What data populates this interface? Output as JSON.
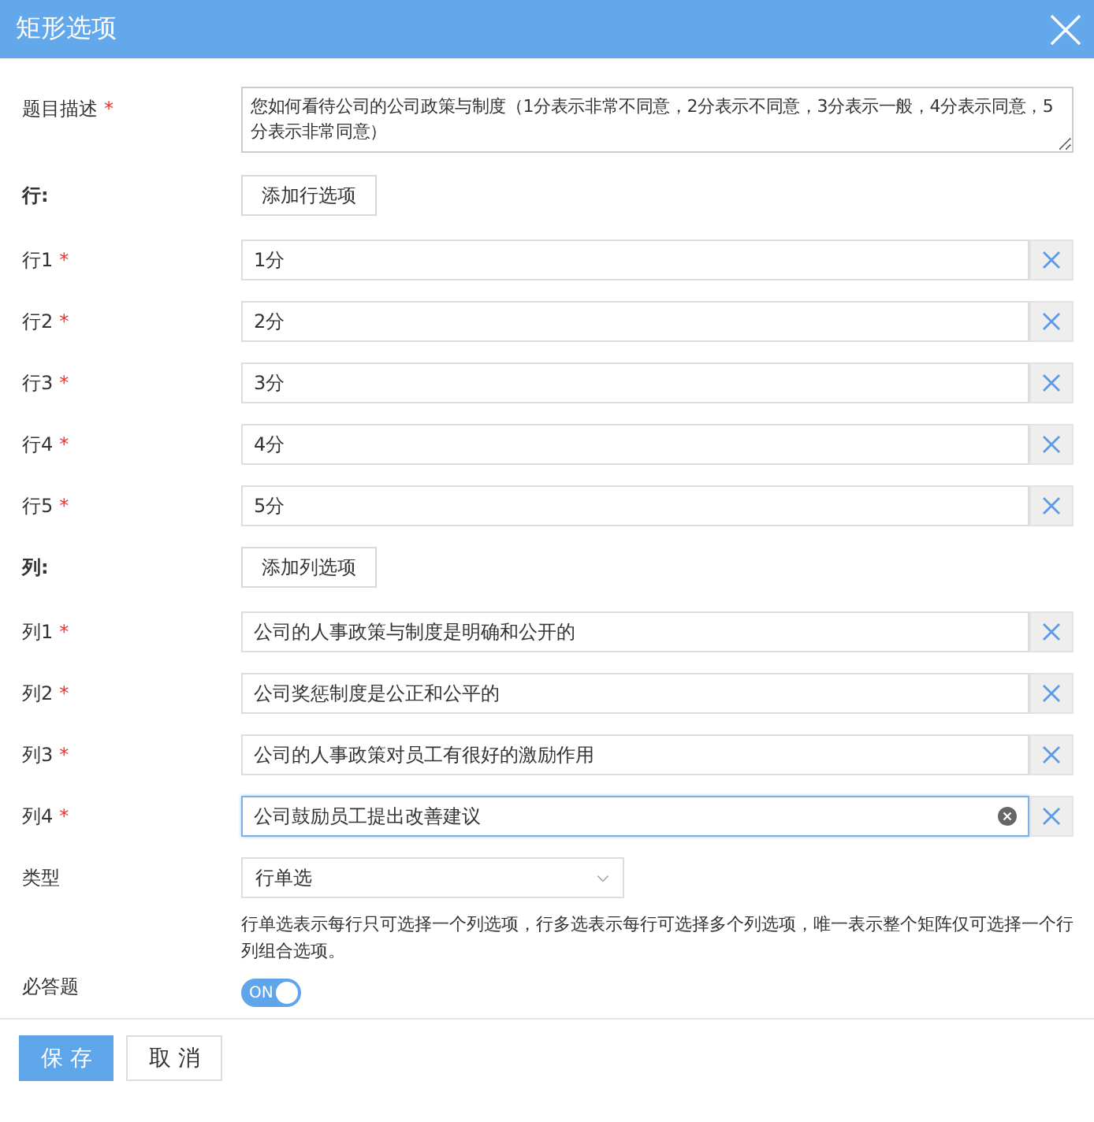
{
  "window": {
    "title": "矩形选项"
  },
  "description": {
    "label": "题目描述",
    "mark": "*",
    "value": "您如何看待公司的公司政策与制度（1分表示非常不同意，2分表示不同意，3分表示一般，4分表示同意，5分表示非常同意）"
  },
  "rows_section": {
    "label": "行:",
    "button": "添加行选项"
  },
  "rows": [
    {
      "label": "行1",
      "mark": "*",
      "value": "1分",
      "focused": false
    },
    {
      "label": "行2",
      "mark": "*",
      "value": "2分",
      "focused": false
    },
    {
      "label": "行3",
      "mark": "*",
      "value": "3分",
      "focused": false
    },
    {
      "label": "行4",
      "mark": "*",
      "value": "4分",
      "focused": false
    },
    {
      "label": "行5",
      "mark": "*",
      "value": "5分",
      "focused": false
    }
  ],
  "columns_section": {
    "label": "列:",
    "button": "添加列选项"
  },
  "columns": [
    {
      "label": "列1",
      "mark": "*",
      "value": "公司的人事政策与制度是明确和公开的",
      "focused": false
    },
    {
      "label": "列2",
      "mark": "*",
      "value": "公司奖惩制度是公正和公平的",
      "focused": false
    },
    {
      "label": "列3",
      "mark": "*",
      "value": "公司的人事政策对员工有很好的激励作用",
      "focused": false
    },
    {
      "label": "列4",
      "mark": "*",
      "value": "公司鼓励员工提出改善建议",
      "focused": true
    }
  ],
  "type": {
    "label": "类型",
    "value": "行单选",
    "help": "行单选表示每行只可选择一个列选项，行多选表示每行可选择多个列选项，唯一表示整个矩阵仅可选择一个行列组合选项。"
  },
  "required_toggle": {
    "label": "必答题",
    "on": true,
    "text": "ON"
  },
  "buttons": [
    {
      "label": "保 存",
      "kind": "primary"
    },
    {
      "label": "取 消",
      "kind": "default"
    }
  ]
}
